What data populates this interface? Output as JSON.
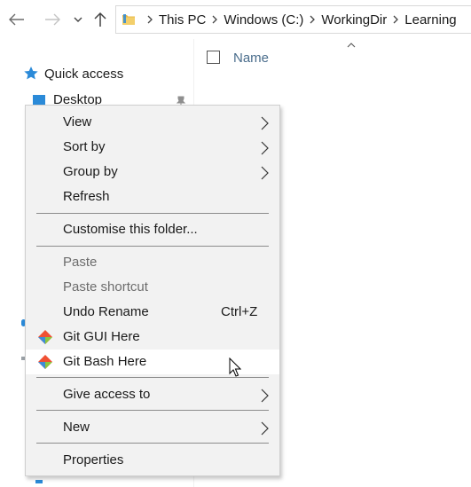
{
  "toolbar": {
    "back_icon": "arrow-left-icon",
    "forward_icon": "arrow-right-icon",
    "recent_icon": "chevron-down-icon",
    "up_icon": "arrow-up-icon"
  },
  "address": {
    "breadcrumbs": [
      "This PC",
      "Windows (C:)",
      "WorkingDir",
      "Learning"
    ]
  },
  "navpane": {
    "quick_access": "Quick access",
    "desktop": "Desktop"
  },
  "filelist": {
    "column_name": "Name"
  },
  "context_menu": {
    "items": [
      {
        "label": "View"
      },
      {
        "label": "Sort by"
      },
      {
        "label": "Group by"
      },
      {
        "label": "Refresh"
      },
      {
        "label": "Customise this folder..."
      },
      {
        "label": "Paste"
      },
      {
        "label": "Paste shortcut"
      },
      {
        "label": "Undo Rename",
        "shortcut": "Ctrl+Z"
      },
      {
        "label": "Git GUI Here"
      },
      {
        "label": "Git Bash Here"
      },
      {
        "label": "Give access to"
      },
      {
        "label": "New"
      },
      {
        "label": "Properties"
      }
    ]
  },
  "colors": {
    "menu_bg": "#f2f2f2",
    "hover_bg": "#ffffff",
    "separator": "#8c8c8c",
    "disabled_text": "#6d6d6d",
    "accent_blue": "#2b8ad8",
    "folder_yellow": "#e8b84a"
  }
}
